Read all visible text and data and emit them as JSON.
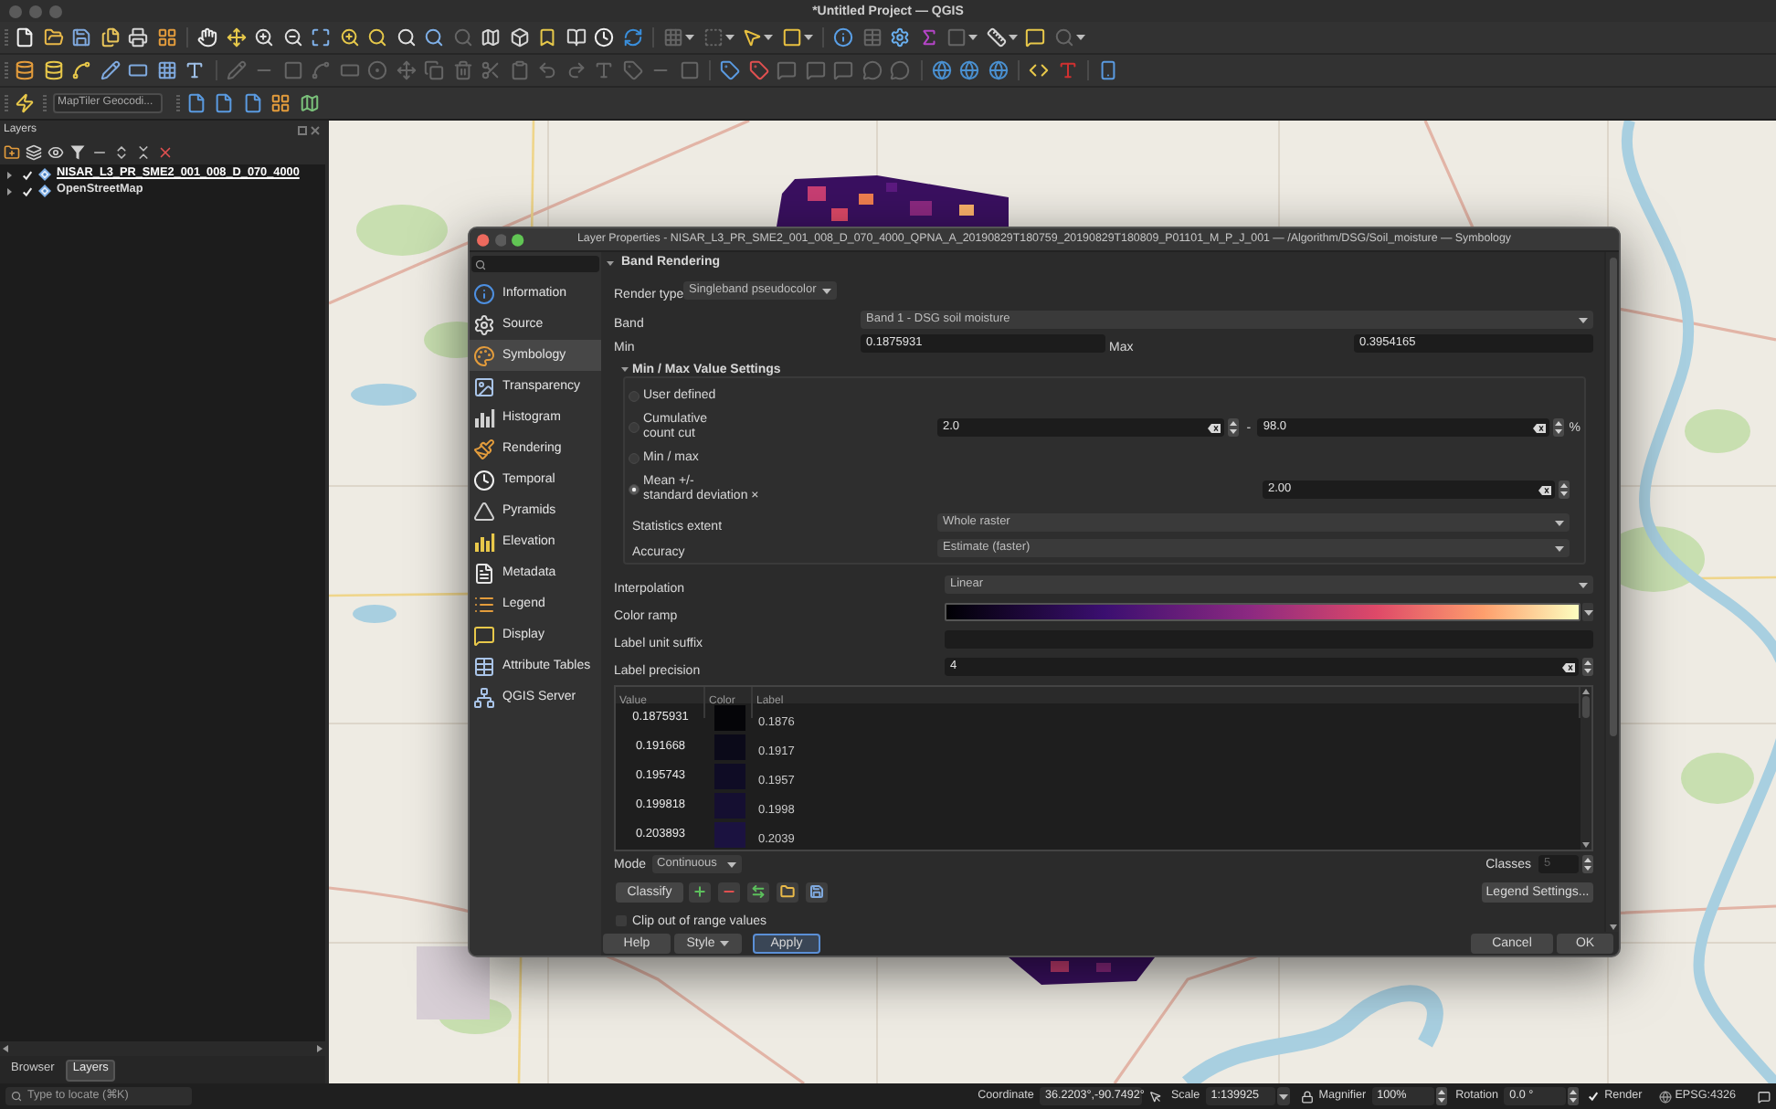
{
  "window": {
    "title": "*Untitled Project — QGIS"
  },
  "toolbars": [
    {
      "groups": [
        [
          {
            "kind": "button",
            "disabled": false
          },
          {
            "kind": "button",
            "disabled": false
          },
          {
            "kind": "button",
            "disabled": false
          },
          {
            "kind": "button",
            "disabled": false
          },
          {
            "kind": "button",
            "disabled": false
          },
          {
            "kind": "button",
            "disabled": false
          }
        ],
        [
          {
            "kind": "button",
            "disabled": false
          },
          {
            "kind": "button",
            "disabled": false
          },
          {
            "kind": "button",
            "disabled": false
          },
          {
            "kind": "button",
            "disabled": false
          },
          {
            "kind": "button",
            "disabled": false
          },
          {
            "kind": "button",
            "disabled": false
          },
          {
            "kind": "button",
            "disabled": false
          },
          {
            "kind": "button",
            "disabled": false
          },
          {
            "kind": "button",
            "disabled": false
          },
          {
            "kind": "button",
            "disabled": true
          },
          {
            "kind": "button",
            "disabled": false
          },
          {
            "kind": "button",
            "disabled": false
          },
          {
            "kind": "button",
            "disabled": false
          },
          {
            "kind": "button",
            "disabled": false
          },
          {
            "kind": "button",
            "disabled": false
          },
          {
            "kind": "button",
            "disabled": false
          }
        ],
        [
          {
            "kind": "menu",
            "disabled": true
          },
          {
            "kind": "menu",
            "disabled": true
          },
          {
            "kind": "menu",
            "disabled": false
          },
          {
            "kind": "menu",
            "disabled": false
          }
        ],
        [
          {
            "kind": "button",
            "disabled": false
          },
          {
            "kind": "button",
            "disabled": true
          },
          {
            "kind": "button",
            "disabled": false
          },
          {
            "kind": "button",
            "disabled": false
          },
          {
            "kind": "menu",
            "disabled": true
          },
          {
            "kind": "menu",
            "disabled": false
          },
          {
            "kind": "button",
            "disabled": false
          },
          {
            "kind": "menu",
            "disabled": true
          }
        ]
      ]
    },
    {
      "groups": [
        [
          {
            "kind": "button",
            "disabled": false
          },
          {
            "kind": "button",
            "disabled": false
          },
          {
            "kind": "button",
            "disabled": false
          },
          {
            "kind": "button",
            "disabled": false
          },
          {
            "kind": "button",
            "disabled": false
          },
          {
            "kind": "button",
            "disabled": false
          },
          {
            "kind": "button",
            "disabled": false
          }
        ],
        [
          {
            "kind": "button",
            "disabled": true
          },
          {
            "kind": "button",
            "disabled": true
          },
          {
            "kind": "button",
            "disabled": true
          },
          {
            "kind": "button",
            "disabled": true
          },
          {
            "kind": "button",
            "disabled": true
          },
          {
            "kind": "button",
            "disabled": true
          },
          {
            "kind": "button",
            "disabled": true
          },
          {
            "kind": "button",
            "disabled": true
          },
          {
            "kind": "button",
            "disabled": true
          },
          {
            "kind": "button",
            "disabled": true
          },
          {
            "kind": "button",
            "disabled": true
          },
          {
            "kind": "button",
            "disabled": true
          },
          {
            "kind": "button",
            "disabled": true
          },
          {
            "kind": "button",
            "disabled": true
          },
          {
            "kind": "button",
            "disabled": true
          },
          {
            "kind": "button",
            "disabled": true
          },
          {
            "kind": "button",
            "disabled": true
          }
        ],
        [
          {
            "kind": "button",
            "disabled": false
          },
          {
            "kind": "button",
            "disabled": false
          },
          {
            "kind": "button",
            "disabled": true
          },
          {
            "kind": "button",
            "disabled": true
          },
          {
            "kind": "button",
            "disabled": true
          },
          {
            "kind": "button",
            "disabled": true
          },
          {
            "kind": "button",
            "disabled": true
          }
        ],
        [
          {
            "kind": "button",
            "disabled": false
          },
          {
            "kind": "button",
            "disabled": false
          },
          {
            "kind": "button",
            "disabled": false
          }
        ],
        [
          {
            "kind": "button",
            "disabled": false
          },
          {
            "kind": "button",
            "disabled": false
          }
        ],
        [
          {
            "kind": "button",
            "disabled": false
          }
        ]
      ]
    }
  ],
  "locator_bar": {
    "leading": [
      {
        "kind": "button",
        "disabled": false
      }
    ],
    "search": {
      "placeholder": "MapTiler Geocodi..."
    },
    "trailing": [
      {
        "kind": "button",
        "disabled": false
      },
      {
        "kind": "button",
        "disabled": false
      },
      {
        "kind": "button",
        "disabled": false
      },
      {
        "kind": "button",
        "disabled": false
      },
      {
        "kind": "button",
        "disabled": false
      }
    ]
  },
  "layers_panel": {
    "title": "Layers",
    "layers": [
      {
        "name": "NISAR_L3_PR_SME2_001_008_D_070_4000",
        "expanded": false,
        "checked": true,
        "selected": true
      },
      {
        "name": "OpenStreetMap",
        "expanded": false,
        "checked": true,
        "selected": false
      }
    ],
    "tabs": [
      {
        "label": "Browser",
        "selected": false
      },
      {
        "label": "Layers",
        "selected": true
      }
    ]
  },
  "dialog": {
    "title": "Layer Properties - NISAR_L3_PR_SME2_001_008_D_070_4000_QPNA_A_20190829T180759_20190829T180809_P01101_M_P_J_001 — /Algorithm/DSG/Soil_moisture — Symbology",
    "sidebar": [
      {
        "label": "Information",
        "selected": false
      },
      {
        "label": "Source",
        "selected": false
      },
      {
        "label": "Symbology",
        "selected": true
      },
      {
        "label": "Transparency",
        "selected": false
      },
      {
        "label": "Histogram",
        "selected": false
      },
      {
        "label": "Rendering",
        "selected": false
      },
      {
        "label": "Temporal",
        "selected": false
      },
      {
        "label": "Pyramids",
        "selected": false
      },
      {
        "label": "Elevation",
        "selected": false
      },
      {
        "label": "Metadata",
        "selected": false
      },
      {
        "label": "Legend",
        "selected": false
      },
      {
        "label": "Display",
        "selected": false
      },
      {
        "label": "Attribute Tables",
        "selected": false
      },
      {
        "label": "QGIS Server",
        "selected": false
      }
    ],
    "band_rendering": {
      "title": "Band Rendering",
      "expanded": true,
      "render_type": {
        "label": "Render type",
        "value": "Singleband pseudocolor"
      },
      "band": {
        "label": "Band",
        "value": "Band 1 - DSG soil moisture"
      },
      "min": {
        "label": "Min",
        "value": "0.1875931"
      },
      "max": {
        "label": "Max",
        "value": "0.3954165"
      },
      "minmax": {
        "title": "Min / Max Value Settings",
        "expanded": true,
        "options": [
          {
            "kind": "plain",
            "label": "User defined",
            "selected": false
          },
          {
            "kind": "range",
            "label": "Cumulative\ncount cut",
            "selected": false,
            "from": "2.0",
            "separator": "-",
            "to": "98.0",
            "unit": "%"
          },
          {
            "kind": "plain",
            "label": "Min / max",
            "selected": false
          },
          {
            "kind": "factor",
            "label": "Mean +/-\nstandard deviation ×",
            "selected": true,
            "value": "2.00"
          }
        ],
        "statistics_extent": {
          "label": "Statistics extent",
          "value": "Whole raster"
        },
        "accuracy": {
          "label": "Accuracy",
          "value": "Estimate (faster)"
        }
      },
      "interpolation": {
        "label": "Interpolation",
        "value": "Linear"
      },
      "color_ramp": {
        "label": "Color ramp"
      },
      "label_unit_suffix": {
        "label": "Label unit suffix"
      },
      "label_precision": {
        "label": "Label precision",
        "value": "4"
      },
      "classes_table": {
        "columns": [
          "Value",
          "Color",
          "Label"
        ],
        "rows": [
          {
            "value": "0.1875931",
            "color": "#050508",
            "label": "0.1876"
          },
          {
            "value": "0.191668",
            "color": "#0b0a19",
            "label": "0.1917"
          },
          {
            "value": "0.195743",
            "color": "#0f0c25",
            "label": "0.1957"
          },
          {
            "value": "0.199818",
            "color": "#150f31",
            "label": "0.1998"
          },
          {
            "value": "0.203893",
            "color": "#1b1240",
            "label": "0.2039"
          }
        ]
      },
      "mode": {
        "label": "Mode",
        "value": "Continuous"
      },
      "classes": {
        "label": "Classes",
        "value": "5",
        "disabled": true
      },
      "classify_button": "Classify",
      "legend_settings_button": "Legend Settings...",
      "clip": {
        "label": "Clip out of range values",
        "checked": false
      }
    },
    "buttons_left": [
      {
        "label": "Help",
        "kind": "button",
        "focused": false
      },
      {
        "label": "Style",
        "kind": "menu",
        "focused": false
      },
      {
        "label": "Apply",
        "kind": "button",
        "focused": true
      }
    ],
    "buttons_right": [
      {
        "label": "Cancel",
        "kind": "button",
        "focused": false
      },
      {
        "label": "OK",
        "kind": "button",
        "focused": false
      }
    ]
  },
  "status_bar": {
    "locator": {
      "placeholder": "Type to locate (⌘K)"
    },
    "coordinate": {
      "label": "Coordinate",
      "value": "36.2203°,-90.7492°"
    },
    "scale": {
      "label": "Scale",
      "value": "1:139925"
    },
    "magnifier": {
      "label": "Magnifier",
      "value": "100%"
    },
    "rotation": {
      "label": "Rotation",
      "value": "0.0 °"
    },
    "render": {
      "label": "Render",
      "checked": true
    },
    "crs": "EPSG:4326"
  }
}
